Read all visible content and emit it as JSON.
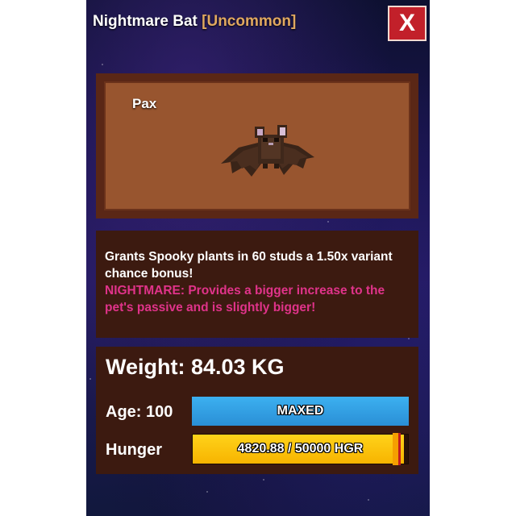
{
  "window": {
    "title": "Nightmare Bat",
    "rarity": "[Uncommon]",
    "close_label": "X"
  },
  "pet": {
    "name": "Pax",
    "model_icon": "bat-pet-model"
  },
  "description": {
    "main": "Grants Spooky plants in 60 studs a 1.50x variant chance bonus!",
    "variant": "NIGHTMARE: Provides a bigger increase to the pet's passive and is slightly bigger!"
  },
  "stats": {
    "weight": "Weight: 84.03 KG",
    "age_label": "Age: 100",
    "age_bar_text": "MAXED",
    "hunger_label": "Hunger",
    "hunger_text": "4820.88 / 50000 HGR",
    "hunger_fill_fraction": 0.98
  },
  "colors": {
    "rarity": "#e0a860",
    "close_button": "#c2202a",
    "age_bar": "#3aa0e0",
    "hunger_bar": "#ffd21a",
    "variant_text": "#e0338a"
  }
}
